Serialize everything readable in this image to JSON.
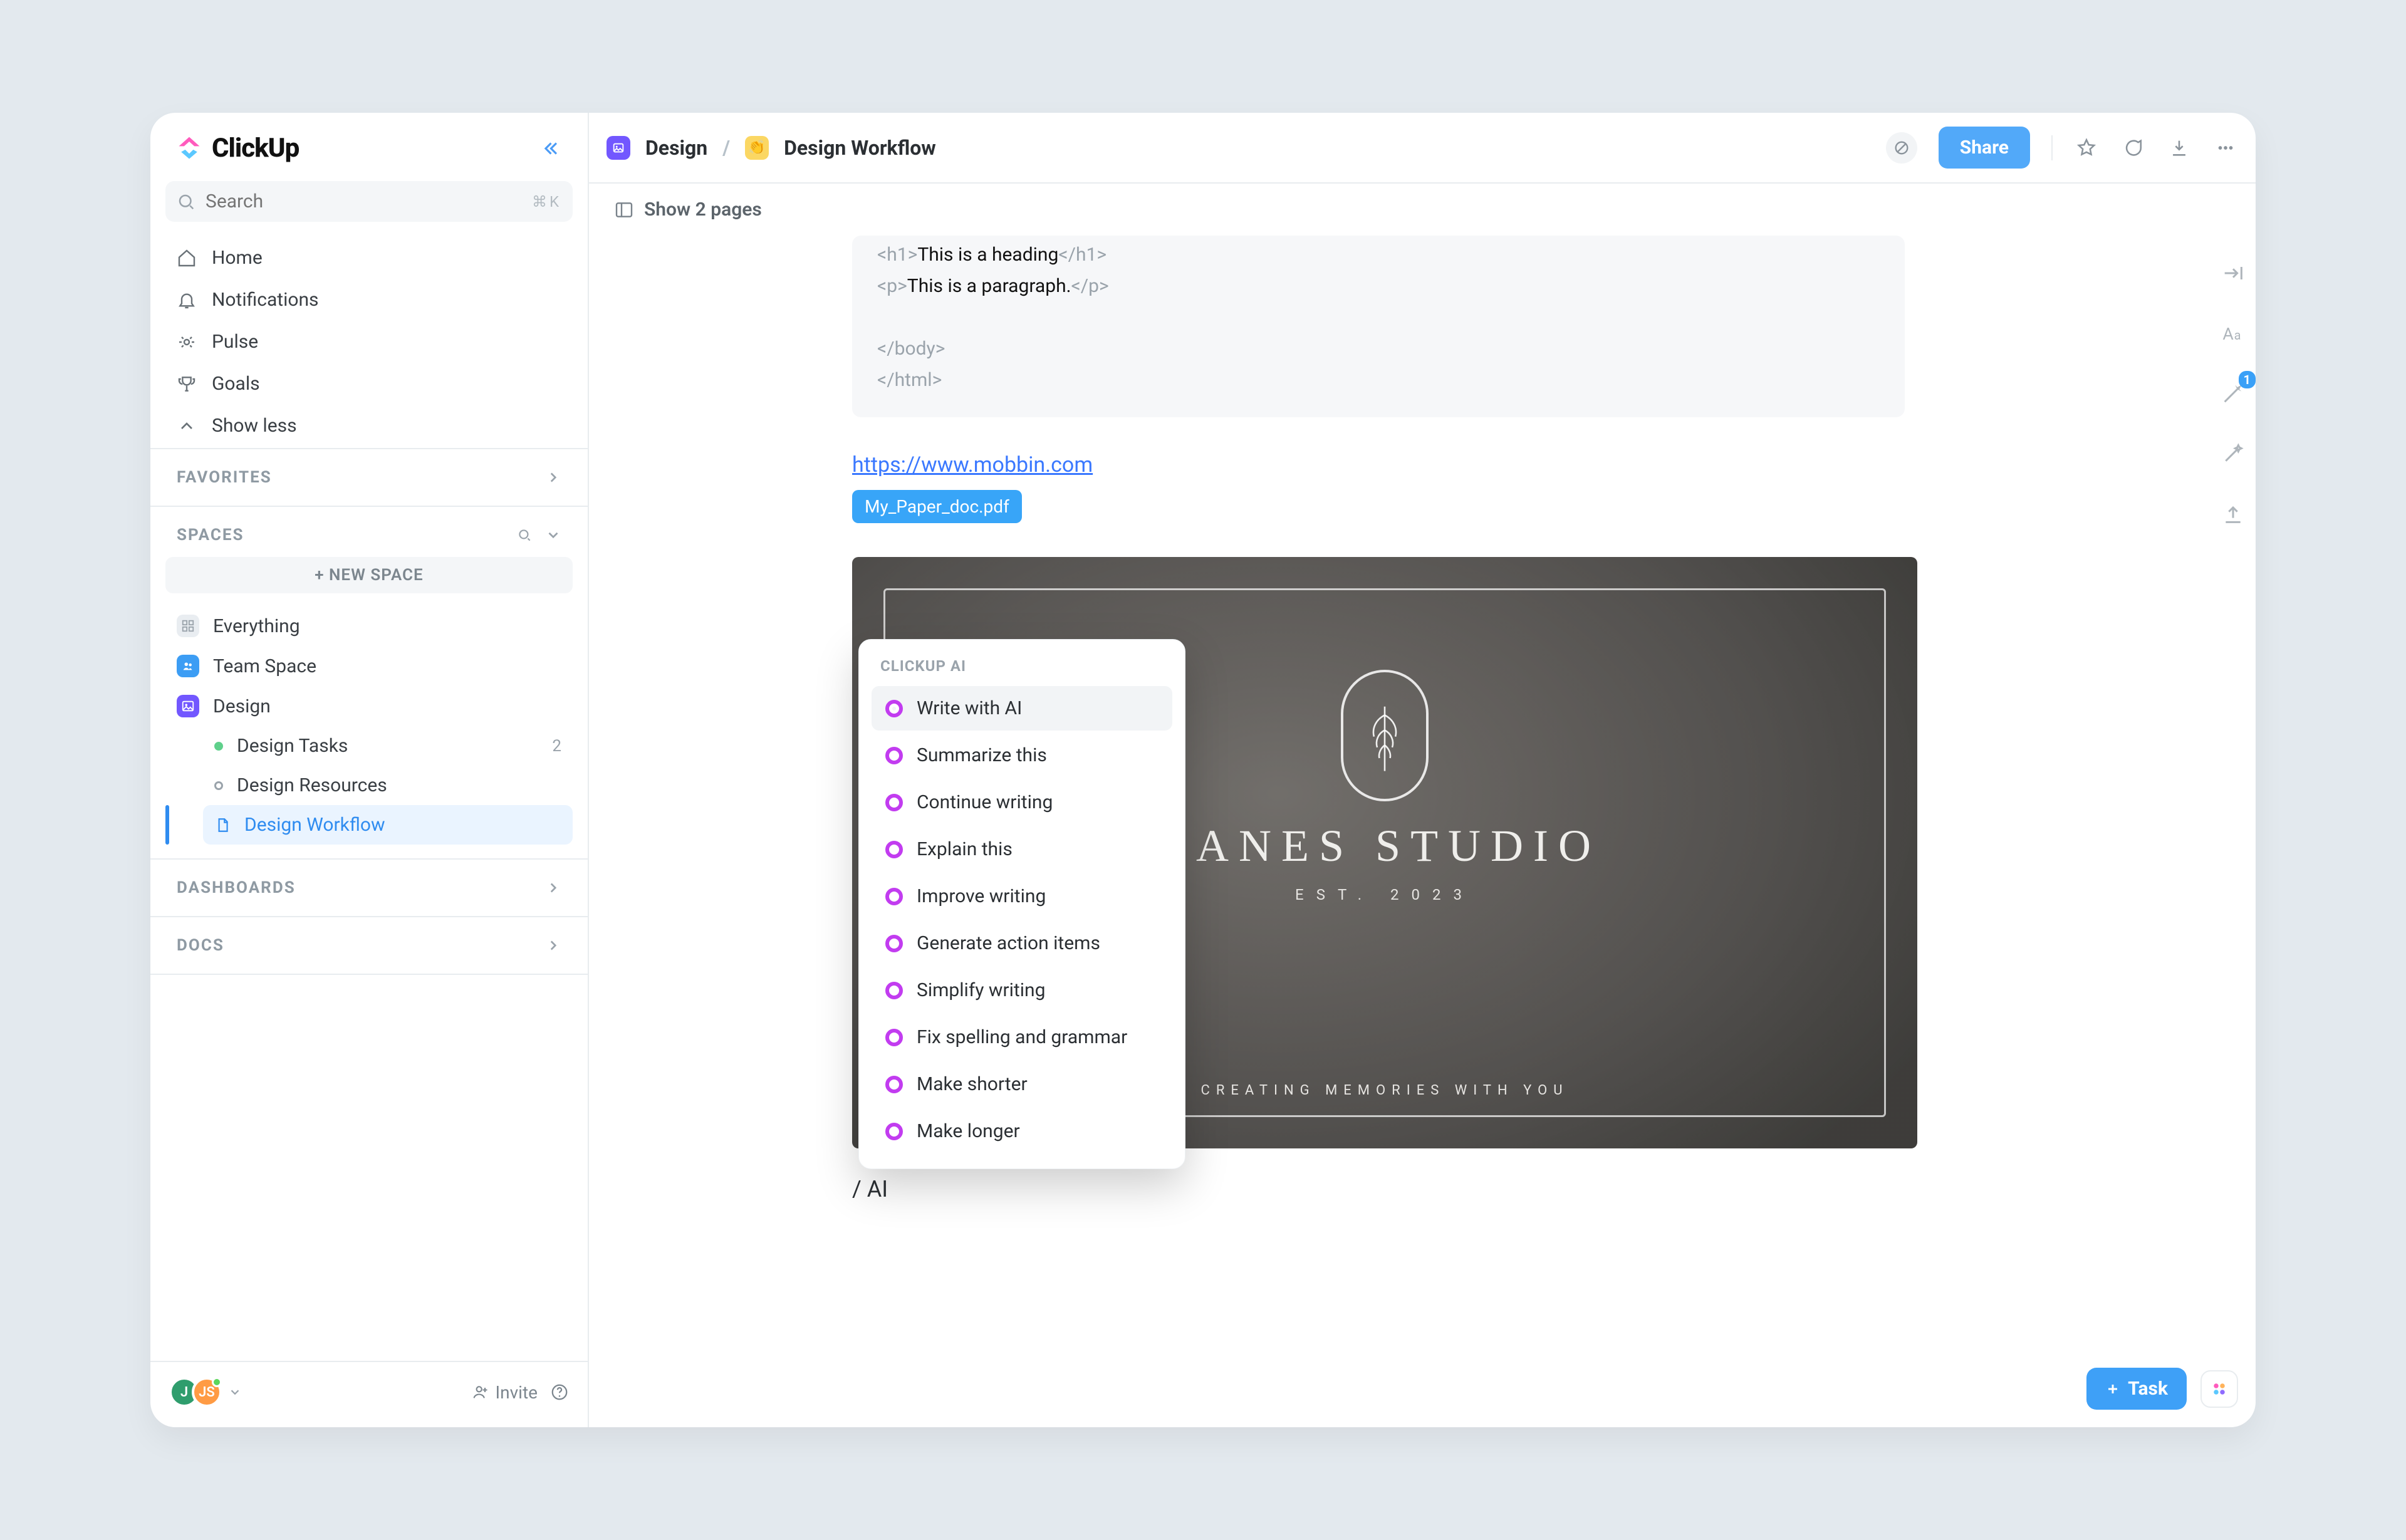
{
  "app": {
    "name": "ClickUp"
  },
  "sidebar": {
    "search_placeholder": "Search",
    "search_kbd": "⌘K",
    "nav": [
      {
        "label": "Home"
      },
      {
        "label": "Notifications"
      },
      {
        "label": "Pulse"
      },
      {
        "label": "Goals"
      },
      {
        "label": "Show less"
      }
    ],
    "favorites_label": "FAVORITES",
    "spaces_label": "SPACES",
    "new_space": "+ NEW SPACE",
    "spaces": [
      {
        "label": "Everything"
      },
      {
        "label": "Team Space"
      },
      {
        "label": "Design"
      }
    ],
    "tree": [
      {
        "label": "Design Tasks",
        "count": "2"
      },
      {
        "label": "Design Resources"
      },
      {
        "label": "Design Workflow"
      }
    ],
    "dashboards_label": "DASHBOARDS",
    "docs_label": "DOCS",
    "footer": {
      "avatar1": "J",
      "avatar2": "JS",
      "invite": "Invite"
    }
  },
  "breadcrumb": {
    "space": "Design",
    "page": "Design Workflow"
  },
  "header_actions": {
    "share": "Share"
  },
  "subheader": {
    "show": "Show 2 pages"
  },
  "code": {
    "l1a": "<h1>",
    "l1b": "This is a heading",
    "l1c": "</h1>",
    "l2a": "<p>",
    "l2b": "This is a paragraph.",
    "l2c": "</p>",
    "l3": "</body>",
    "l4": "</html>"
  },
  "doc": {
    "link": "https://www.mobbin.com",
    "chip": "My_Paper_doc.pdf",
    "slash": "/ AI"
  },
  "image": {
    "title": "JANES STUDIO",
    "sub": "EST. 2023",
    "tag": "CREATING MEMORIES WITH YOU"
  },
  "ai_menu": {
    "title": "CLICKUP AI",
    "items": [
      "Write with AI",
      "Summarize this",
      "Continue writing",
      "Explain this",
      "Improve writing",
      "Generate action items",
      "Simplify writing",
      "Fix spelling and grammar",
      "Make shorter",
      "Make longer"
    ]
  },
  "rail": {
    "badge": "1"
  },
  "bottom": {
    "task": "Task"
  }
}
